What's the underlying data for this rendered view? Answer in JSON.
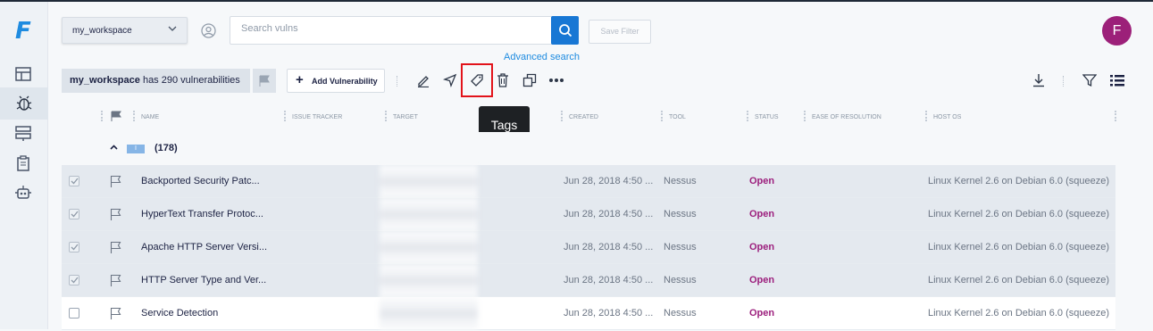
{
  "app": {
    "logo": "F"
  },
  "sidebar": {
    "items": [
      "dashboard-icon",
      "bug-icon",
      "server-icon",
      "clipboard-icon",
      "robot-icon"
    ]
  },
  "header": {
    "workspace_select": "my_workspace",
    "search_placeholder": "Search vulns",
    "save_filter_label": "Save Filter",
    "advanced_search_label": "Advanced search",
    "avatar_letter": "F"
  },
  "toolbar": {
    "workspace_name": "my_workspace",
    "has_text": " has 290 vulnerabilities",
    "add_vuln_label": "Add Vulnerability",
    "tooltip": "Tags"
  },
  "table": {
    "columns": [
      "NAME",
      "ISSUE TRACKER",
      "TARGET",
      "CREATED",
      "TOOL",
      "STATUS",
      "EASE OF RESOLUTION",
      "HOST OS"
    ],
    "group": {
      "tag": "I",
      "count": "(178)"
    },
    "rows": [
      {
        "selected": true,
        "name": "Backported Security Patc...",
        "created": "Jun 28, 2018 4:50 ...",
        "tool": "Nessus",
        "status": "Open",
        "host_os": "Linux Kernel 2.6 on Debian 6.0 (squeeze)"
      },
      {
        "selected": true,
        "name": "HyperText Transfer Protoc...",
        "created": "Jun 28, 2018 4:50 ...",
        "tool": "Nessus",
        "status": "Open",
        "host_os": "Linux Kernel 2.6 on Debian 6.0 (squeeze)"
      },
      {
        "selected": true,
        "name": "Apache HTTP Server Versi...",
        "created": "Jun 28, 2018 4:50 ...",
        "tool": "Nessus",
        "status": "Open",
        "host_os": "Linux Kernel 2.6 on Debian 6.0 (squeeze)"
      },
      {
        "selected": true,
        "name": "HTTP Server Type and Ver...",
        "created": "Jun 28, 2018 4:50 ...",
        "tool": "Nessus",
        "status": "Open",
        "host_os": "Linux Kernel 2.6 on Debian 6.0 (squeeze)"
      },
      {
        "selected": false,
        "name": "Service Detection",
        "created": "Jun 28, 2018 4:50 ...",
        "tool": "Nessus",
        "status": "Open",
        "host_os": "Linux Kernel 2.6 on Debian 6.0 (squeeze)"
      }
    ]
  },
  "colors": {
    "accent": "#1877d4",
    "status_open": "#9c1f7d",
    "avatar": "#9c2079",
    "highlight": "#e2131a"
  }
}
